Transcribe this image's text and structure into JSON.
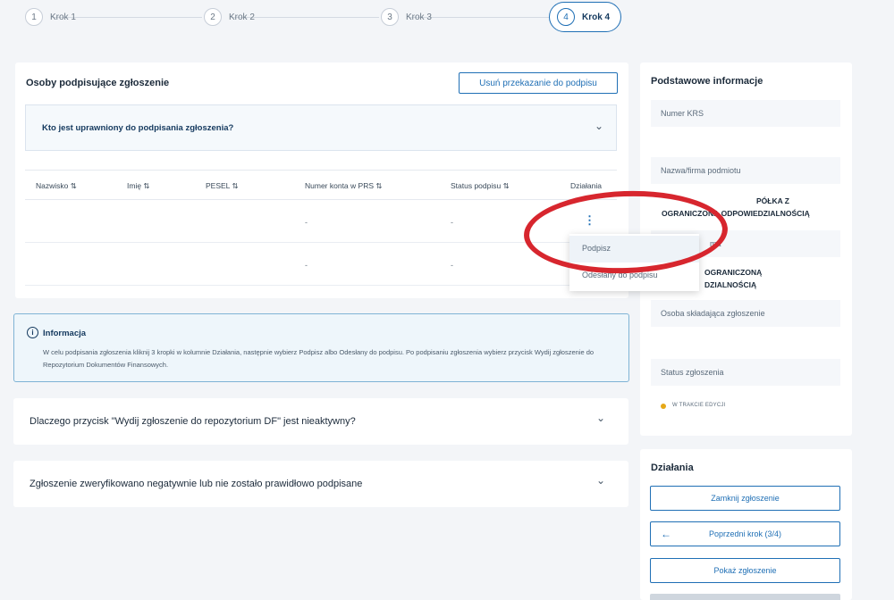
{
  "stepper": {
    "steps": [
      {
        "num": "1",
        "label": "Krok 1"
      },
      {
        "num": "2",
        "label": "Krok 2"
      },
      {
        "num": "3",
        "label": "Krok 3"
      },
      {
        "num": "4",
        "label": "Krok 4"
      }
    ]
  },
  "signers": {
    "title": "Osoby podpisujące zgłoszenie",
    "remove_button": "Usuń przekazanie do podpisu",
    "question": "Kto jest uprawniony do podpisania zgłoszenia?",
    "columns": [
      "Nazwisko ⇅",
      "Imię ⇅",
      "PESEL ⇅",
      "Numer konta w PRS ⇅",
      "Status podpisu ⇅",
      "Działania"
    ],
    "rows": [
      {
        "account": "-",
        "status": "-"
      },
      {
        "account": "-",
        "status": "-"
      }
    ],
    "kebab": "⋮"
  },
  "menu": {
    "items": [
      "Podpisz",
      "Odesłany do podpisu"
    ]
  },
  "info": {
    "title": "Informacja",
    "text": "W celu podpisania zgłoszenia kliknij 3 kropki w kolumnie Działania, następnie wybierz Podpisz albo Odesłany do podpisu. Po podpisaniu zgłoszenia wybierz przycisk Wydij zgłoszenie do Repozytorium Dokumentów Finansowych."
  },
  "accordions": [
    "Dlaczego przycisk \"Wydij zgłoszenie do repozytorium DF\" jest nieaktywny?",
    "Zgłoszenie zweryfikowano negatywnie lub nie zostało prawidłowo podpisane"
  ],
  "basic": {
    "title": "Podstawowe informacje",
    "krs_label": "Numer KRS",
    "name_label": "Nazwa/firma podmiotu",
    "name_value_1": "PÓŁKA Z",
    "name_value_2": "OGRANICZONĄ ODPOWIEDZIALNOŚCIĄ",
    "hidden_label": "ma",
    "hidden_value_1": "OGRANICZONĄ",
    "hidden_value_2": "DZIALNOŚCIĄ",
    "submitter_label": "Osoba składająca zgłoszenie",
    "status_label": "Status zgłoszenia",
    "status_value": "W TRAKCIE EDYCJI",
    "status_color": "#e6a817"
  },
  "actions": {
    "title": "Działania",
    "close_button": "Zamknij zgłoszenie",
    "prev_button": "Poprzedni krok (3/4)",
    "show_button": "Pokaż zgłoszenie"
  },
  "colors": {
    "accent": "#1f6fb5",
    "annotation": "#d7262e"
  }
}
